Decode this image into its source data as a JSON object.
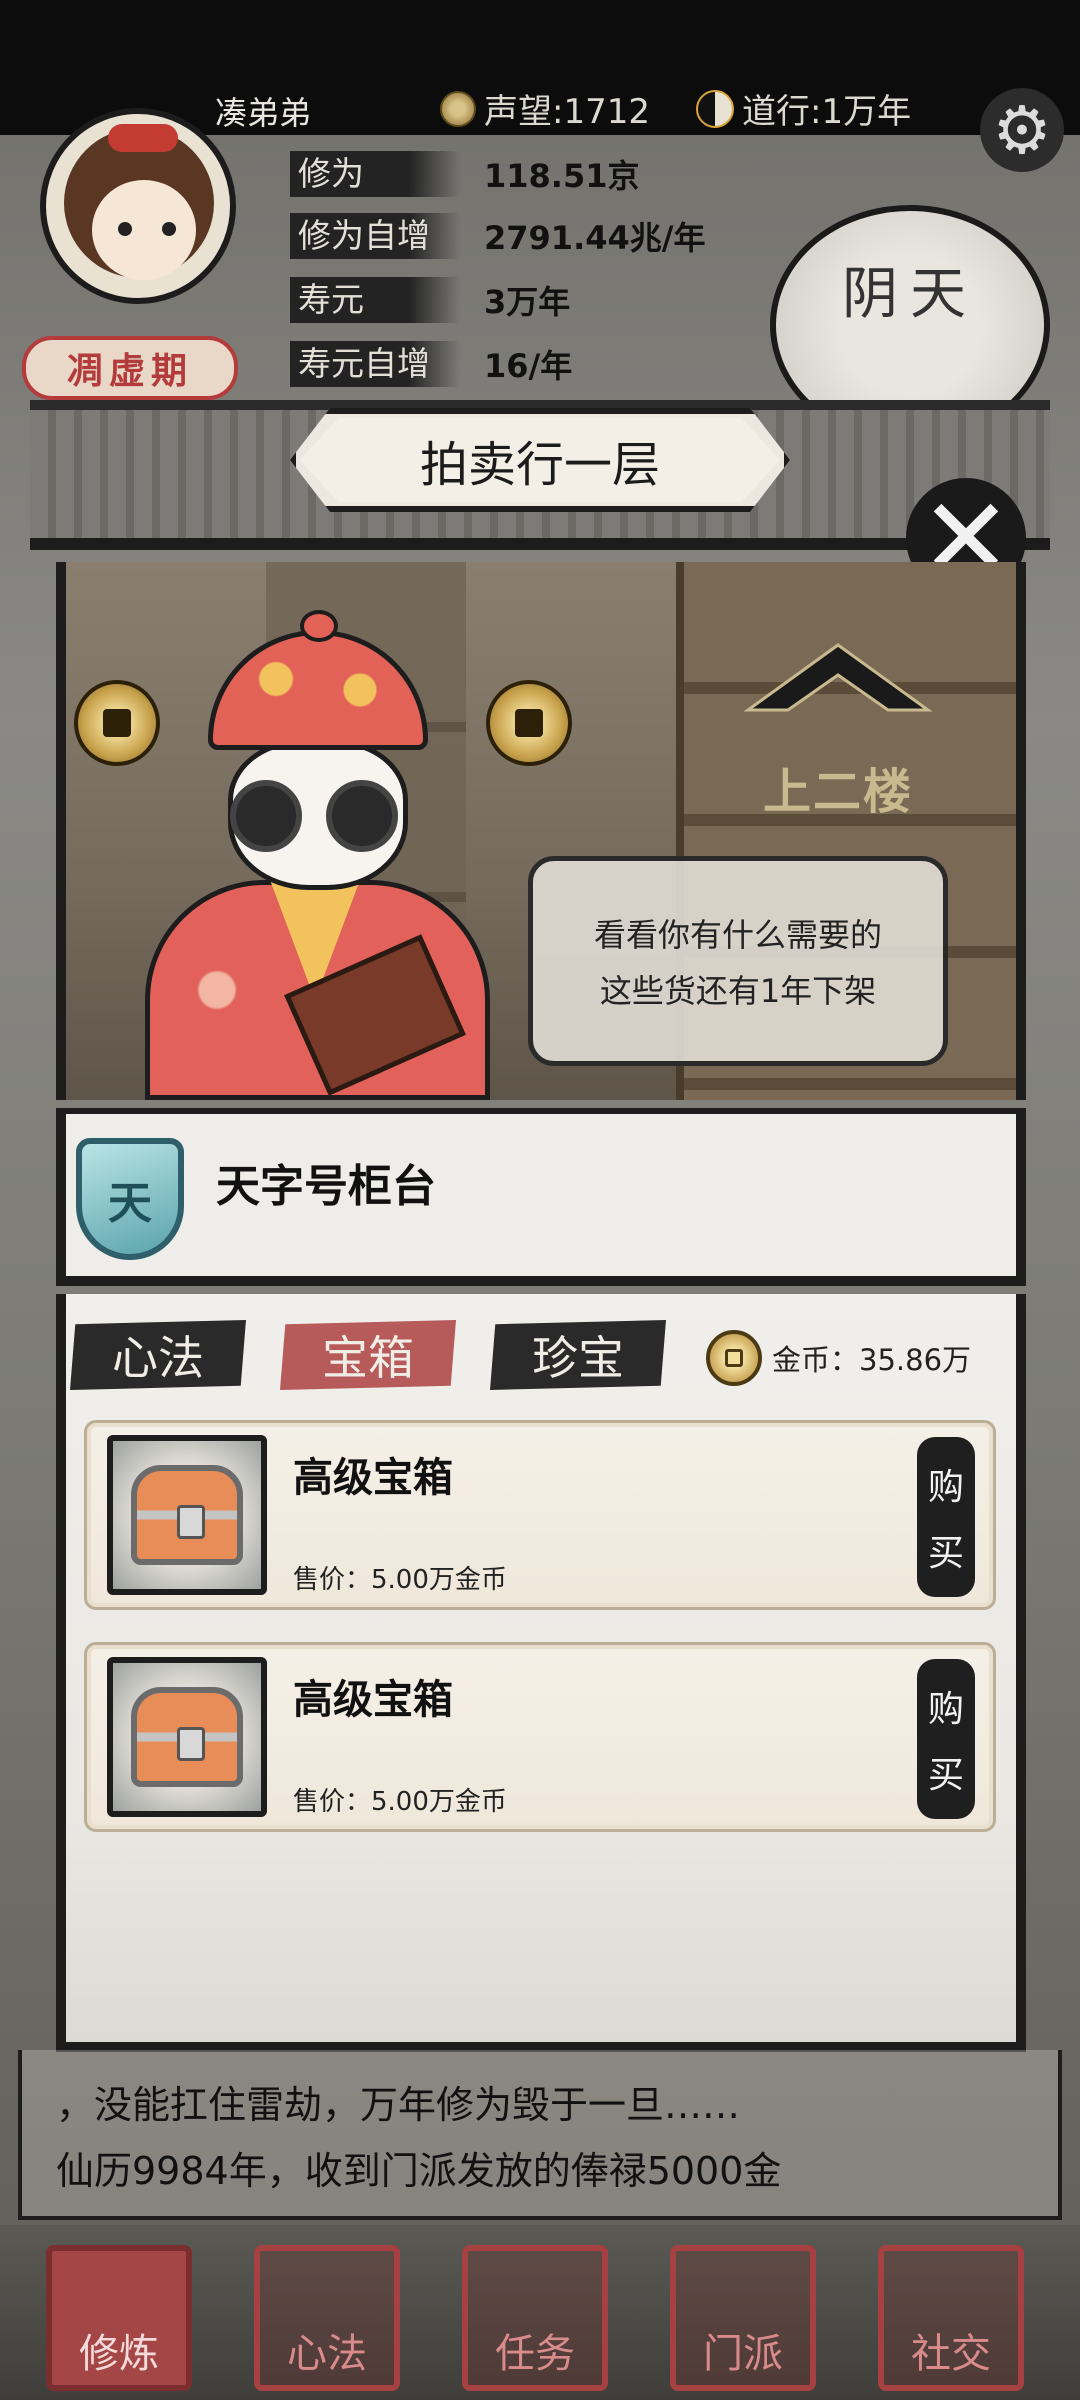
{
  "header": {
    "player_name": "凑弟弟",
    "reputation": "声望:1712",
    "dao_progress": "道行:1万年",
    "rank": "凋虚期",
    "weather": "阴天"
  },
  "stats": [
    {
      "label": "修为",
      "value": "118.51京"
    },
    {
      "label": "修为自增",
      "value": "2791.44兆/年"
    },
    {
      "label": "寿元",
      "value": "3万年"
    },
    {
      "label": "寿元自增",
      "value": "16/年"
    }
  ],
  "shop": {
    "title": "拍卖行一层",
    "upstairs_label": "上二楼",
    "speech_line1": "看看你有什么需要的",
    "speech_line2": "这些货还有1年下架",
    "counter_badge": "天",
    "counter_title": "天字号柜台",
    "tabs": [
      "心法",
      "宝箱",
      "珍宝"
    ],
    "active_tab": "宝箱",
    "gold": "金币：35.86万",
    "items": [
      {
        "name": "高级宝箱",
        "price": "售价：5.00万金币",
        "buy_top": "购",
        "buy_bottom": "买"
      },
      {
        "name": "高级宝箱",
        "price": "售价：5.00万金币",
        "buy_top": "购",
        "buy_bottom": "买"
      }
    ]
  },
  "log": {
    "line1": "，没能扛住雷劫，万年修为毁于一旦……",
    "line2": "仙历9984年，收到门派发放的俸禄5000金"
  },
  "nav": [
    "修炼",
    "心法",
    "任务",
    "门派",
    "社交"
  ],
  "colors": {
    "accent_red": "#b65a5a",
    "panel_bg": "#efedea",
    "ink": "#1d1d1d"
  }
}
